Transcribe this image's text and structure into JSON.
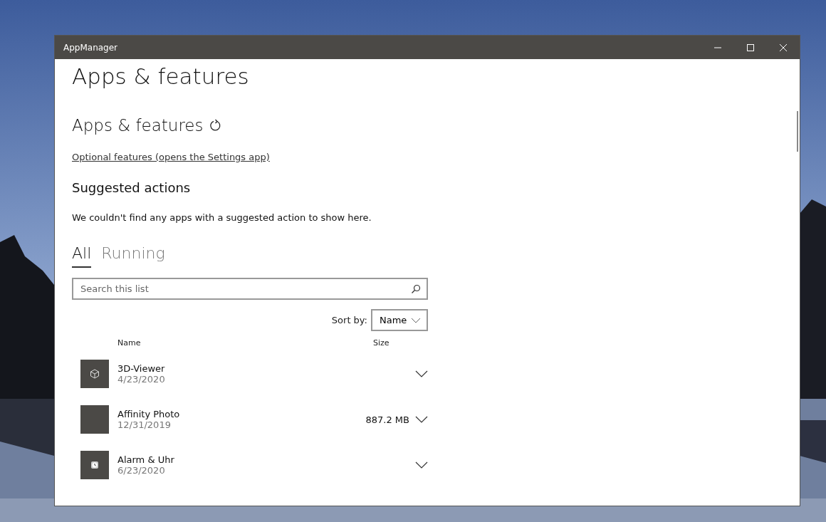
{
  "window": {
    "title": "AppManager"
  },
  "page_title": "Apps & features",
  "section_title": "Apps & features",
  "optional_features_link": "Optional features (opens the Settings app)",
  "suggested_actions": {
    "title": "Suggested actions",
    "message": "We couldn't find any apps with a suggested action to show here."
  },
  "tabs": [
    {
      "label": "All",
      "selected": true
    },
    {
      "label": "Running",
      "selected": false
    }
  ],
  "search": {
    "placeholder": "Search this list"
  },
  "sort": {
    "label": "Sort by:",
    "value": "Name"
  },
  "columns": [
    "Name",
    "Size"
  ],
  "apps": [
    {
      "name": "3D-Viewer",
      "date": "4/23/2020",
      "kind": "cube"
    },
    {
      "name": "Affinity Photo",
      "date": "12/31/2019",
      "size": "887.2 MB",
      "kind": "blank"
    },
    {
      "name": "Alarm & Uhr",
      "date": "6/23/2020",
      "kind": "clock"
    }
  ]
}
